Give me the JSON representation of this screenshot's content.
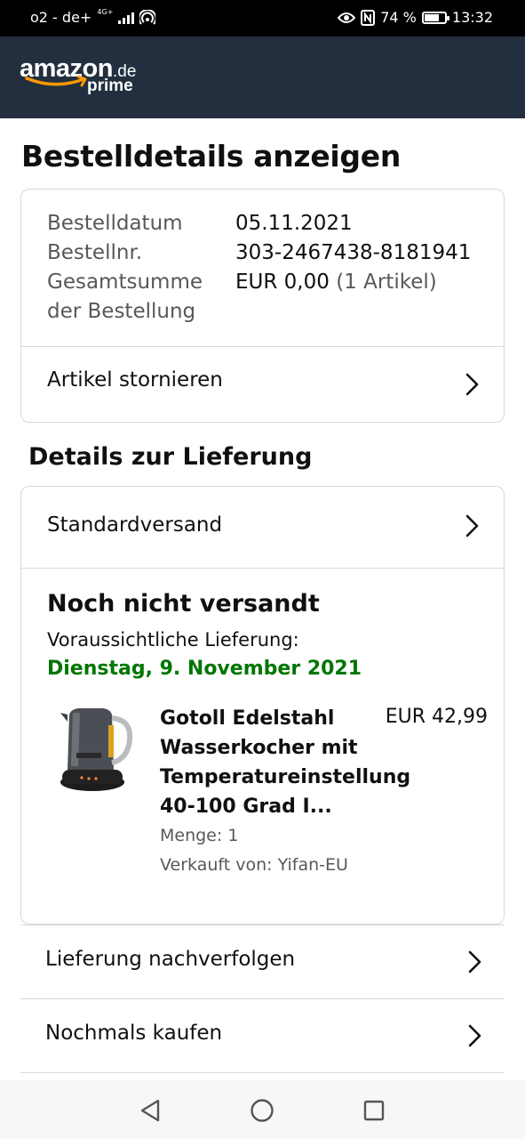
{
  "status_bar": {
    "carrier": "o2 - de+",
    "network_type": "4G+",
    "battery_percent_label": "74 %",
    "battery_level": 0.74,
    "time": "13:32"
  },
  "header": {
    "logo_word": "amazon",
    "logo_tld": ".de",
    "logo_sub": "prime",
    "background": "#232f3e",
    "accent": "#ff9900"
  },
  "page": {
    "title": "Bestelldetails anzeigen"
  },
  "order_summary": {
    "rows": [
      {
        "label": "Bestelldatum",
        "value": "05.11.2021"
      },
      {
        "label": "Bestellnr.",
        "value": "303-2467438-8181941"
      },
      {
        "label": "Gesamtsumme der Bestellung",
        "value": "EUR 0,00",
        "note": "(1 Artikel)"
      }
    ],
    "cancel_label": "Artikel stornieren"
  },
  "delivery": {
    "section_title": "Details zur Lieferung",
    "shipping_method": "Standardversand",
    "status": "Noch nicht versandt",
    "eta_label": "Voraussichtliche Lieferung:",
    "eta_date": "Dienstag, 9. November 2021",
    "eta_color": "#007600",
    "product": {
      "title": "Gotoll Edelstahl Wasserkocher mit Temperatureinstellung 40-100 Grad I...",
      "price": "EUR 42,99",
      "quantity": "Menge: 1",
      "seller": "Verkauft von: Yifan-EU",
      "image_icon": "kettle-image"
    }
  },
  "actions": [
    {
      "label": "Lieferung nachverfolgen"
    },
    {
      "label": "Nochmals kaufen"
    }
  ],
  "nav_bar": {
    "icons": [
      "back-icon",
      "home-icon",
      "recents-icon"
    ]
  }
}
